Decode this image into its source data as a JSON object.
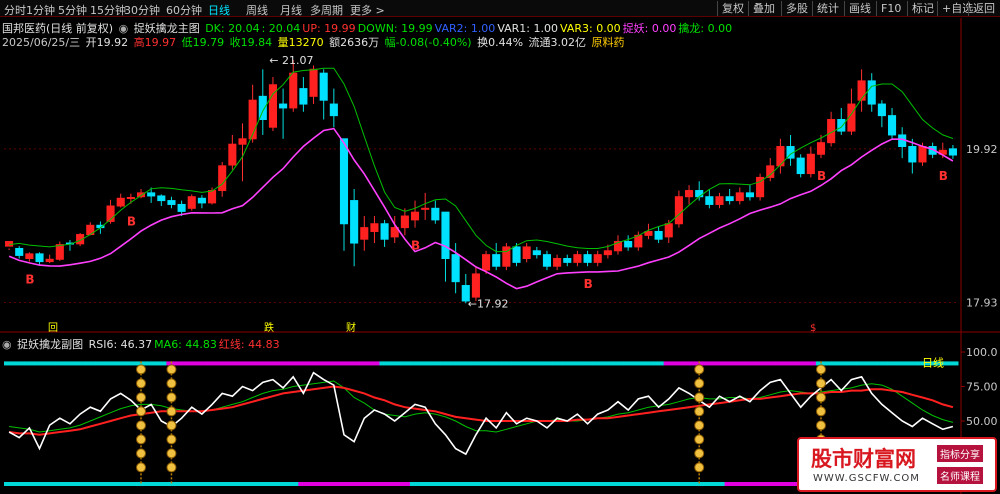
{
  "toolbar": {
    "timeframes": [
      "分时",
      "1分钟",
      "5分钟",
      "15分钟",
      "30分钟",
      "60分钟",
      "日线",
      "周线",
      "月线",
      "多周期",
      "更多 >"
    ],
    "active": "日线",
    "right_buttons": [
      "复权",
      "叠加",
      "多股",
      "统计",
      "画线",
      "F10",
      "标记",
      "+自选",
      "返回"
    ]
  },
  "main_header": {
    "stock": "国邦医药(日线 前复权)",
    "indicator": "捉妖擒龙主图",
    "items": [
      {
        "text": "DK: 20.04",
        "color": "#00e000"
      },
      {
        "text": ": 20.04",
        "color": "#00e000"
      },
      {
        "text": "UP: 19.99",
        "color": "#ff3030"
      },
      {
        "text": "DOWN: 19.99",
        "color": "#00e000"
      },
      {
        "text": "VAR2: 1.00",
        "color": "#3060ff"
      },
      {
        "text": "VAR1: 1.00",
        "color": "#e0e0e0"
      },
      {
        "text": "VAR3: 0.00",
        "color": "#ffff00"
      },
      {
        "text": "捉妖: 0.00",
        "color": "#ff40ff"
      },
      {
        "text": "擒龙: 0.00",
        "color": "#00e000"
      }
    ]
  },
  "quote": {
    "date": "2025/06/25/三",
    "open": "开19.92",
    "high": "高19.97",
    "low": "低19.79",
    "close": "收19.84",
    "volume": "量13270",
    "amount": "额2636万",
    "change": "幅-0.08(-0.40%)",
    "turnover": "换0.44%",
    "float": "流通3.02亿",
    "concept": "原料药"
  },
  "price_axis": {
    "upper": "19.92",
    "lower": "17.93",
    "high_ticks": [
      "100.0",
      "75.00",
      "50.00"
    ]
  },
  "annotations": {
    "peak": "21.07",
    "trough": "17.92",
    "line_label": "日线",
    "top_markers": [
      "回",
      "跌",
      "财",
      "$"
    ]
  },
  "sub_header": {
    "title": "捉妖擒龙副图",
    "items": [
      {
        "text": "RSI6: 46.37",
        "color": "#e0e0e0"
      },
      {
        "text": "MA6: 44.83",
        "color": "#00e000"
      },
      {
        "text": "红线: 44.83",
        "color": "#ff3030"
      }
    ]
  },
  "watermark": {
    "title": "股市财富网",
    "url": "WWW.GSCFW.COM",
    "tag1": "指标分享",
    "tag2": "名师课程"
  },
  "chart_data": {
    "type": "candlestick",
    "price_ylim": [
      17.6,
      21.2
    ],
    "candles": [
      [
        18.66,
        18.72,
        18.61,
        18.63
      ],
      [
        18.63,
        18.54,
        18.5,
        18.66
      ],
      [
        18.5,
        18.56,
        18.46,
        18.58
      ],
      [
        18.56,
        18.46,
        18.41,
        18.58
      ],
      [
        18.46,
        18.49,
        18.44,
        18.55
      ],
      [
        18.49,
        18.68,
        18.47,
        18.72
      ],
      [
        18.7,
        18.69,
        18.6,
        18.74
      ],
      [
        18.69,
        18.81,
        18.66,
        18.83
      ],
      [
        18.81,
        18.93,
        18.8,
        18.97
      ],
      [
        18.93,
        18.9,
        18.82,
        18.98
      ],
      [
        18.98,
        19.18,
        18.95,
        19.26
      ],
      [
        19.18,
        19.28,
        19.16,
        19.34
      ],
      [
        19.28,
        19.29,
        19.21,
        19.34
      ],
      [
        19.3,
        19.35,
        19.28,
        19.4
      ],
      [
        19.35,
        19.31,
        19.22,
        19.42
      ],
      [
        19.31,
        19.25,
        19.18,
        19.33
      ],
      [
        19.25,
        19.2,
        19.15,
        19.3
      ],
      [
        19.2,
        19.11,
        19.05,
        19.25
      ],
      [
        19.15,
        19.3,
        19.12,
        19.33
      ],
      [
        19.28,
        19.22,
        19.15,
        19.32
      ],
      [
        19.22,
        19.38,
        19.2,
        19.42
      ],
      [
        19.38,
        19.7,
        19.3,
        19.75
      ],
      [
        19.71,
        19.98,
        19.65,
        20.1
      ],
      [
        19.98,
        20.05,
        19.5,
        20.25
      ],
      [
        20.05,
        20.55,
        20.0,
        20.75
      ],
      [
        20.6,
        20.3,
        20.1,
        20.95
      ],
      [
        20.2,
        20.75,
        20.15,
        20.85
      ],
      [
        20.5,
        20.45,
        20.05,
        20.7
      ],
      [
        20.45,
        20.9,
        20.4,
        21.07
      ],
      [
        20.7,
        20.5,
        20.4,
        20.85
      ],
      [
        20.6,
        20.95,
        20.5,
        21.0
      ],
      [
        20.9,
        20.55,
        20.3,
        20.95
      ],
      [
        20.5,
        20.35,
        20.2,
        20.7
      ],
      [
        20.05,
        18.95,
        18.6,
        20.05
      ],
      [
        19.25,
        18.7,
        18.4,
        19.4
      ],
      [
        18.75,
        18.9,
        18.6,
        19.05
      ],
      [
        18.85,
        18.95,
        18.7,
        19.05
      ],
      [
        18.95,
        18.75,
        18.65,
        19.0
      ],
      [
        18.78,
        18.9,
        18.7,
        19.05
      ],
      [
        18.9,
        19.05,
        18.8,
        19.15
      ],
      [
        19.0,
        19.1,
        18.9,
        19.25
      ],
      [
        19.15,
        19.15,
        19.0,
        19.35
      ],
      [
        19.15,
        19.0,
        18.95,
        19.25
      ],
      [
        19.1,
        18.5,
        18.2,
        19.1
      ],
      [
        18.55,
        18.2,
        18.05,
        18.7
      ],
      [
        18.15,
        17.95,
        17.92,
        18.3
      ],
      [
        18.0,
        18.3,
        17.95,
        18.4
      ],
      [
        18.35,
        18.55,
        18.3,
        18.6
      ],
      [
        18.55,
        18.4,
        18.35,
        18.7
      ],
      [
        18.4,
        18.65,
        18.35,
        18.7
      ],
      [
        18.65,
        18.45,
        18.4,
        18.7
      ],
      [
        18.5,
        18.65,
        18.45,
        18.7
      ],
      [
        18.6,
        18.55,
        18.5,
        18.65
      ],
      [
        18.55,
        18.4,
        18.35,
        18.6
      ],
      [
        18.4,
        18.5,
        18.35,
        18.55
      ],
      [
        18.5,
        18.45,
        18.4,
        18.55
      ],
      [
        18.45,
        18.55,
        18.4,
        18.6
      ],
      [
        18.55,
        18.45,
        18.4,
        18.6
      ],
      [
        18.45,
        18.55,
        18.4,
        18.6
      ],
      [
        18.55,
        18.6,
        18.5,
        18.68
      ],
      [
        18.6,
        18.72,
        18.55,
        18.8
      ],
      [
        18.72,
        18.65,
        18.6,
        18.8
      ],
      [
        18.65,
        18.8,
        18.6,
        18.85
      ],
      [
        18.8,
        18.85,
        18.75,
        18.95
      ],
      [
        18.85,
        18.75,
        18.7,
        18.92
      ],
      [
        18.78,
        18.95,
        18.7,
        19.0
      ],
      [
        18.95,
        19.3,
        18.9,
        19.38
      ],
      [
        19.3,
        19.38,
        19.2,
        19.45
      ],
      [
        19.38,
        19.3,
        19.25,
        19.5
      ],
      [
        19.3,
        19.2,
        19.15,
        19.4
      ],
      [
        19.2,
        19.3,
        19.15,
        19.35
      ],
      [
        19.3,
        19.25,
        19.2,
        19.4
      ],
      [
        19.25,
        19.35,
        19.2,
        19.42
      ],
      [
        19.35,
        19.3,
        19.25,
        19.45
      ],
      [
        19.3,
        19.55,
        19.25,
        19.6
      ],
      [
        19.55,
        19.7,
        19.5,
        19.8
      ],
      [
        19.7,
        19.95,
        19.6,
        20.05
      ],
      [
        19.95,
        19.8,
        19.7,
        20.1
      ],
      [
        19.8,
        19.6,
        19.55,
        19.85
      ],
      [
        19.6,
        19.85,
        19.55,
        19.95
      ],
      [
        19.85,
        20.0,
        19.8,
        20.1
      ],
      [
        20.0,
        20.3,
        19.95,
        20.4
      ],
      [
        20.3,
        20.15,
        20.1,
        20.45
      ],
      [
        20.15,
        20.5,
        20.1,
        20.7
      ],
      [
        20.55,
        20.8,
        20.4,
        20.95
      ],
      [
        20.8,
        20.5,
        20.4,
        20.9
      ],
      [
        20.5,
        20.35,
        20.2,
        20.55
      ],
      [
        20.35,
        20.1,
        20.05,
        20.45
      ],
      [
        20.1,
        19.95,
        19.8,
        20.2
      ],
      [
        19.95,
        19.75,
        19.6,
        20.05
      ],
      [
        19.75,
        19.95,
        19.7,
        20.0
      ],
      [
        19.95,
        19.85,
        19.8,
        20.0
      ],
      [
        19.85,
        19.9,
        19.8,
        20.0
      ],
      [
        19.92,
        19.84,
        19.79,
        19.97
      ]
    ],
    "markers": [
      {
        "i": 2,
        "type": "R"
      },
      {
        "i": 12,
        "type": "R"
      },
      {
        "i": 40,
        "type": "R"
      },
      {
        "i": 57,
        "type": "R"
      },
      {
        "i": 80,
        "type": "R"
      },
      {
        "i": 92,
        "type": "R"
      }
    ],
    "sub_ylim": [
      0,
      100
    ],
    "rsi6": [
      42,
      38,
      45,
      30,
      47,
      52,
      48,
      55,
      60,
      57,
      66,
      70,
      65,
      58,
      62,
      50,
      46,
      52,
      60,
      55,
      62,
      70,
      68,
      75,
      72,
      78,
      80,
      74,
      82,
      70,
      85,
      80,
      76,
      40,
      35,
      52,
      58,
      55,
      50,
      56,
      62,
      60,
      48,
      40,
      30,
      26,
      40,
      52,
      45,
      56,
      48,
      52,
      50,
      45,
      52,
      50,
      55,
      48,
      55,
      58,
      64,
      58,
      66,
      68,
      60,
      66,
      74,
      70,
      65,
      60,
      68,
      64,
      68,
      64,
      72,
      78,
      80,
      70,
      60,
      68,
      74,
      80,
      72,
      80,
      82,
      70,
      62,
      56,
      50,
      46,
      52,
      48,
      44,
      46
    ],
    "ma6": [
      46,
      45,
      44,
      42,
      43,
      44,
      45,
      47,
      50,
      53,
      56,
      59,
      61,
      62,
      62,
      61,
      59,
      58,
      57,
      57,
      58,
      60,
      62,
      64,
      67,
      70,
      72,
      73,
      75,
      76,
      77,
      78,
      79,
      74,
      67,
      63,
      58,
      55,
      54,
      53,
      55,
      56,
      55,
      53,
      50,
      46,
      43,
      43,
      42,
      44,
      46,
      48,
      50,
      50,
      51,
      50,
      50,
      51,
      52,
      53,
      55,
      56,
      58,
      60,
      61,
      62,
      64,
      66,
      67,
      66,
      66,
      67,
      67,
      66,
      67,
      69,
      71,
      72,
      71,
      70,
      71,
      72,
      73,
      74,
      76,
      77,
      76,
      73,
      68,
      63,
      58,
      54,
      51,
      49
    ],
    "red_line": [
      42,
      41,
      41,
      40,
      41,
      42,
      43,
      44,
      46,
      48,
      50,
      52,
      54,
      55,
      56,
      57,
      57,
      57,
      57,
      57,
      58,
      59,
      60,
      62,
      64,
      66,
      68,
      70,
      71,
      72,
      73,
      74,
      75,
      74,
      72,
      70,
      67,
      65,
      62,
      60,
      59,
      58,
      57,
      55,
      53,
      52,
      51,
      50,
      50,
      50,
      50,
      50,
      50,
      50,
      50,
      50,
      51,
      51,
      52,
      52,
      53,
      54,
      55,
      56,
      57,
      58,
      59,
      60,
      61,
      62,
      63,
      64,
      65,
      66,
      66,
      67,
      68,
      69,
      70,
      70,
      70,
      71,
      71,
      72,
      72,
      73,
      73,
      72,
      71,
      69,
      67,
      65,
      62,
      60
    ]
  }
}
